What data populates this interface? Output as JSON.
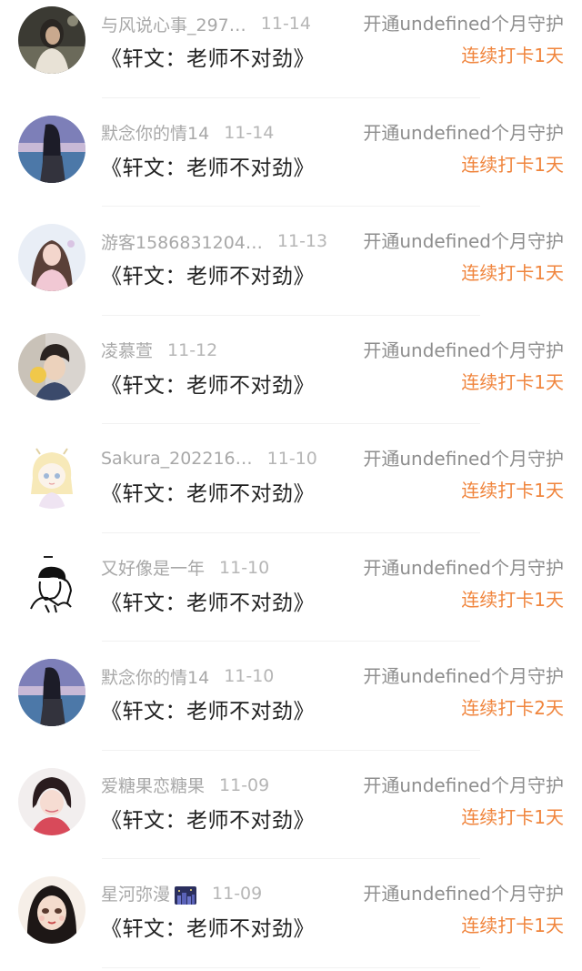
{
  "colors": {
    "streak": "#f0853d",
    "meta": "#a8a8a8",
    "title": "#222222",
    "action": "#8e8e8e"
  },
  "records": [
    {
      "user": "与风说心事_297…",
      "date": "11-14",
      "work": "《轩文：老师不对劲》",
      "action": "开通undefined个月守护",
      "streak": "连续打卡1天",
      "avatar": "girl-dark-portrait-avatar"
    },
    {
      "user": "默念你的情14",
      "date": "11-14",
      "work": "《轩文：老师不对劲》",
      "action": "开通undefined个月守护",
      "streak": "连续打卡1天",
      "avatar": "girl-seaside-avatar"
    },
    {
      "user": "游客1586831204…",
      "date": "11-13",
      "work": "《轩文：老师不对劲》",
      "action": "开通undefined个月守护",
      "streak": "连续打卡1天",
      "avatar": "girl-pink-photo-avatar"
    },
    {
      "user": "凌慕萱",
      "date": "11-12",
      "work": "《轩文：老师不对劲》",
      "action": "开通undefined个月守护",
      "streak": "连续打卡1天",
      "avatar": "boy-portrait-avatar"
    },
    {
      "user": "Sakura_202216…",
      "date": "11-10",
      "work": "《轩文：老师不对劲》",
      "action": "开通undefined个月守护",
      "streak": "连续打卡1天",
      "avatar": "anime-girl-sketch-avatar"
    },
    {
      "user": "又好像是一年",
      "date": "11-10",
      "work": "《轩文：老师不对劲》",
      "action": "开通undefined个月守护",
      "streak": "连续打卡1天",
      "avatar": "couple-line-art-avatar"
    },
    {
      "user": "默念你的情14",
      "date": "11-10",
      "work": "《轩文：老师不对劲》",
      "action": "开通undefined个月守护",
      "streak": "连续打卡2天",
      "avatar": "girl-seaside-avatar"
    },
    {
      "user": "爱糖果恋糖果",
      "date": "11-09",
      "work": "《轩文：老师不对劲》",
      "action": "开通undefined个月守护",
      "streak": "连续打卡1天",
      "avatar": "girl-red-hair-avatar"
    },
    {
      "user": "星河弥漫",
      "date": "11-09",
      "work": "《轩文：老师不对劲》",
      "action": "开通undefined个月守护",
      "streak": "连续打卡1天",
      "avatar": "illustrated-girl-avatar",
      "name_emoji": "night-city-emoji"
    }
  ]
}
